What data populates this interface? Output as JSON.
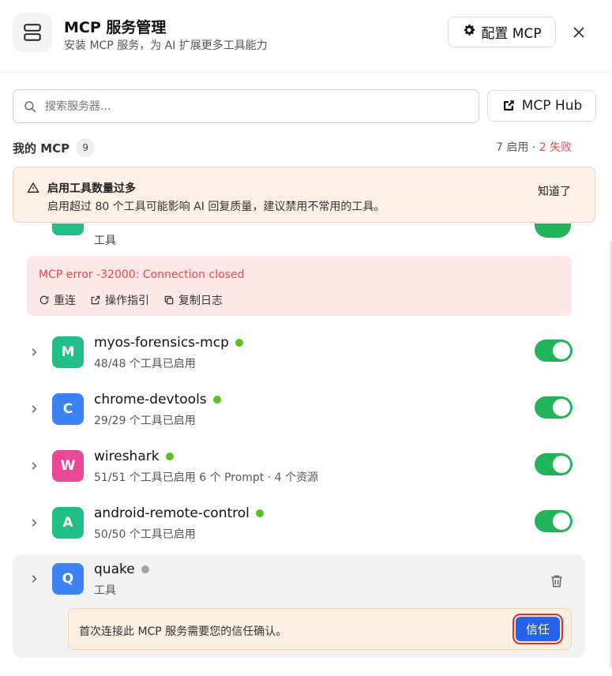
{
  "header": {
    "title": "MCP 服务管理",
    "subtitle": "安装 MCP 服务，为 AI 扩展更多工具能力",
    "config_label": "配置 MCP"
  },
  "search": {
    "placeholder": "搜索服务器..."
  },
  "hub": {
    "label": "MCP Hub"
  },
  "section": {
    "title": "我的 MCP",
    "count": "9",
    "enabled_text": "7 启用 · ",
    "failed_text": "2 失败"
  },
  "warning": {
    "title": "启用工具数量过多",
    "text": "启用超过 80 个工具可能影响 AI 回复质量，建议禁用不常用的工具。",
    "dismiss": "知道了"
  },
  "partial_server": {
    "subtitle": "工具"
  },
  "error": {
    "message": "MCP error -32000: Connection closed",
    "actions": {
      "reconnect": "重连",
      "guide": "操作指引",
      "copy_log": "复制日志"
    }
  },
  "servers": [
    {
      "initial": "M",
      "name": "myos-forensics-mcp",
      "subtitle": "48/48 个工具已启用",
      "avatar_color": "#1fbf86",
      "status_color": "#52c41a",
      "enabled": true
    },
    {
      "initial": "C",
      "name": "chrome-devtools",
      "subtitle": "29/29 个工具已启用",
      "avatar_color": "#3b82f6",
      "status_color": "#52c41a",
      "enabled": true
    },
    {
      "initial": "W",
      "name": "wireshark",
      "subtitle": "51/51 个工具已启用 6 个 Prompt · 4 个资源",
      "avatar_color": "#ec4899",
      "status_color": "#52c41a",
      "enabled": true
    },
    {
      "initial": "A",
      "name": "android-remote-control",
      "subtitle": "50/50 个工具已启用",
      "avatar_color": "#1fbf86",
      "status_color": "#52c41a",
      "enabled": true
    }
  ],
  "quake": {
    "initial": "Q",
    "name": "quake",
    "subtitle": "工具",
    "avatar_color": "#3b82f6",
    "status_color": "#9ca3af",
    "trust_text": "首次连接此 MCP 服务需要您的信任确认。",
    "trust_button": "信任"
  }
}
